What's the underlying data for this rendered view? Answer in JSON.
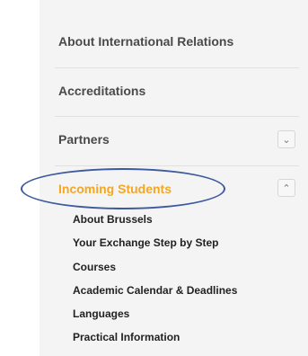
{
  "menu": {
    "items": [
      {
        "label": "About International Relations"
      },
      {
        "label": "Accreditations"
      },
      {
        "label": "Partners",
        "toggle": "chevron-down"
      },
      {
        "label": "Incoming Students",
        "toggle": "chevron-up",
        "active": true
      }
    ],
    "subitems": [
      "About Brussels",
      "Your Exchange Step by Step",
      "Courses",
      "Academic Calendar & Deadlines",
      "Languages",
      "Practical Information"
    ]
  },
  "colors": {
    "active": "#f5a623",
    "highlight_ellipse": "#3d5a9e"
  }
}
